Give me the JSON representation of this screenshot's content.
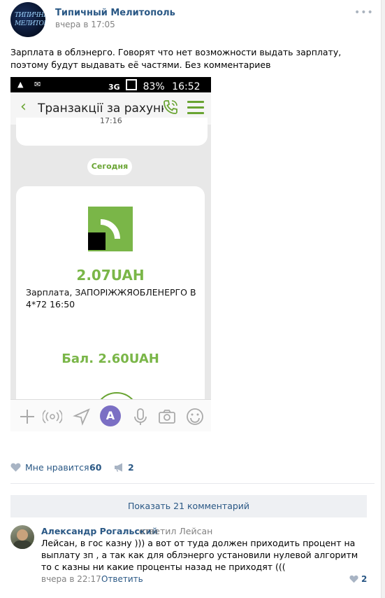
{
  "post": {
    "group_name": "Типичный Мелитополь",
    "time": "вчера в 17:05",
    "more_icon": "more-dots-icon",
    "avatar_text": [
      "ТИПИЧНЫЙ",
      "МЕЛИТОПОЛЬ"
    ],
    "text": "Зарплата в облэнерго. Говорят что нет возможности выдать зарплату, поэтому будут выдавать её частями. Без комментариев"
  },
  "phone": {
    "status_left": "▲ ✉",
    "network": "3G",
    "battery": "83%",
    "clock": "16:52",
    "app_title": "Транзакції за рахунк…",
    "prev_message_time": "17:16",
    "date_chip": "Сегодня",
    "amount": "2.07UAH",
    "description": "Зарплата, ЗАПОРІЖЖЯОБЛЕНЕРГО В 4*72 16:50",
    "balance": "Бал. 2.60UAH",
    "input_letter": "A",
    "colors": {
      "accent_green": "#7ab648",
      "viber_purple": "#7b6fc4"
    }
  },
  "actions": {
    "like_label": "Мне нравится",
    "like_count": "60",
    "share_count": "2"
  },
  "comments": {
    "show_more": "Показать 21 комментарий",
    "items": [
      {
        "author": "Александр Рогальский",
        "reply_to": "ответил Лейсан",
        "text": "Лейсан, в гос казну ))) а вот от туда должен приходить процент на выплату зп , а так как для облэнерго установили нулевой алгоритм то с казны ни какие проценты назад не приходят (((",
        "time": "вчера в 22:17",
        "reply_label": "Ответить",
        "likes": "2"
      }
    ]
  },
  "colors": {
    "link": "#2a5885",
    "muted": "#828282"
  }
}
